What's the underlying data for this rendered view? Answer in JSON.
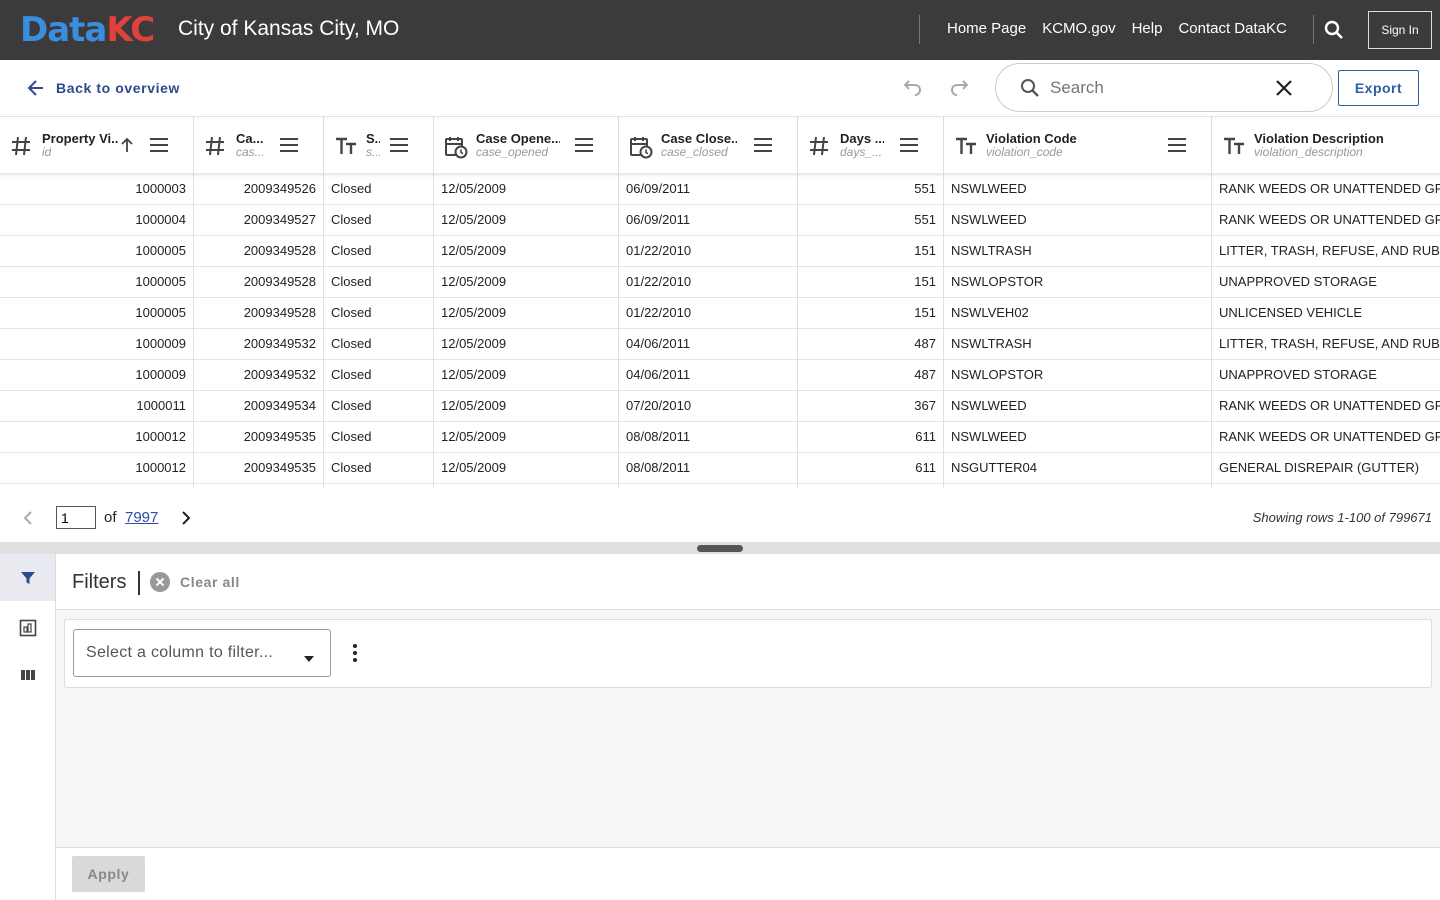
{
  "header": {
    "logo_left": "Data",
    "logo_right": "KC",
    "site_title": "City of Kansas City, MO",
    "nav": [
      "Home Page",
      "KCMO.gov",
      "Help",
      "Contact DataKC"
    ],
    "sign_in": "Sign In"
  },
  "toolbar": {
    "back_label": "Back to overview",
    "search_placeholder": "Search",
    "export_label": "Export"
  },
  "columns": [
    {
      "title": "Property Vi...",
      "sub": "id",
      "type": "number",
      "sorted": "ascending"
    },
    {
      "title": "Ca...",
      "sub": "cas...",
      "type": "number"
    },
    {
      "title": "S...",
      "sub": "s...",
      "type": "text"
    },
    {
      "title": "Case Opene...",
      "sub": "case_opened",
      "type": "date"
    },
    {
      "title": "Case Close...",
      "sub": "case_closed",
      "type": "date"
    },
    {
      "title": "Days ...",
      "sub": "days_...",
      "type": "number"
    },
    {
      "title": "Violation Code",
      "sub": "violation_code",
      "type": "text"
    },
    {
      "title": "Violation Description",
      "sub": "violation_description",
      "type": "text"
    }
  ],
  "rows": [
    [
      "1000003",
      "2009349526",
      "Closed",
      "12/05/2009",
      "06/09/2011",
      "551",
      "NSWLWEED",
      "RANK WEEDS OR UNATTENDED GROWTH"
    ],
    [
      "1000004",
      "2009349527",
      "Closed",
      "12/05/2009",
      "06/09/2011",
      "551",
      "NSWLWEED",
      "RANK WEEDS OR UNATTENDED GROWTH"
    ],
    [
      "1000005",
      "2009349528",
      "Closed",
      "12/05/2009",
      "01/22/2010",
      "151",
      "NSWLTRASH",
      "LITTER, TRASH, REFUSE, AND RUBBISH"
    ],
    [
      "1000005",
      "2009349528",
      "Closed",
      "12/05/2009",
      "01/22/2010",
      "151",
      "NSWLOPSTOR",
      "UNAPPROVED STORAGE"
    ],
    [
      "1000005",
      "2009349528",
      "Closed",
      "12/05/2009",
      "01/22/2010",
      "151",
      "NSWLVEH02",
      "UNLICENSED VEHICLE"
    ],
    [
      "1000009",
      "2009349532",
      "Closed",
      "12/05/2009",
      "04/06/2011",
      "487",
      "NSWLTRASH",
      "LITTER, TRASH, REFUSE, AND RUBBISH"
    ],
    [
      "1000009",
      "2009349532",
      "Closed",
      "12/05/2009",
      "04/06/2011",
      "487",
      "NSWLOPSTOR",
      "UNAPPROVED STORAGE"
    ],
    [
      "1000011",
      "2009349534",
      "Closed",
      "12/05/2009",
      "07/20/2010",
      "367",
      "NSWLWEED",
      "RANK WEEDS OR UNATTENDED GROWTH"
    ],
    [
      "1000012",
      "2009349535",
      "Closed",
      "12/05/2009",
      "08/08/2011",
      "611",
      "NSWLWEED",
      "RANK WEEDS OR UNATTENDED GROWTH"
    ],
    [
      "1000012",
      "2009349535",
      "Closed",
      "12/05/2009",
      "08/08/2011",
      "611",
      "NSGUTTER04",
      "GENERAL DISREPAIR (GUTTER)"
    ]
  ],
  "pager": {
    "current_page": "1",
    "of_label": "of",
    "total_pages": "7997",
    "showing": "Showing rows 1-100 of 799671"
  },
  "filters": {
    "title": "Filters",
    "clear_all": "Clear all",
    "select_placeholder": "Select a column to filter...",
    "apply_label": "Apply"
  }
}
